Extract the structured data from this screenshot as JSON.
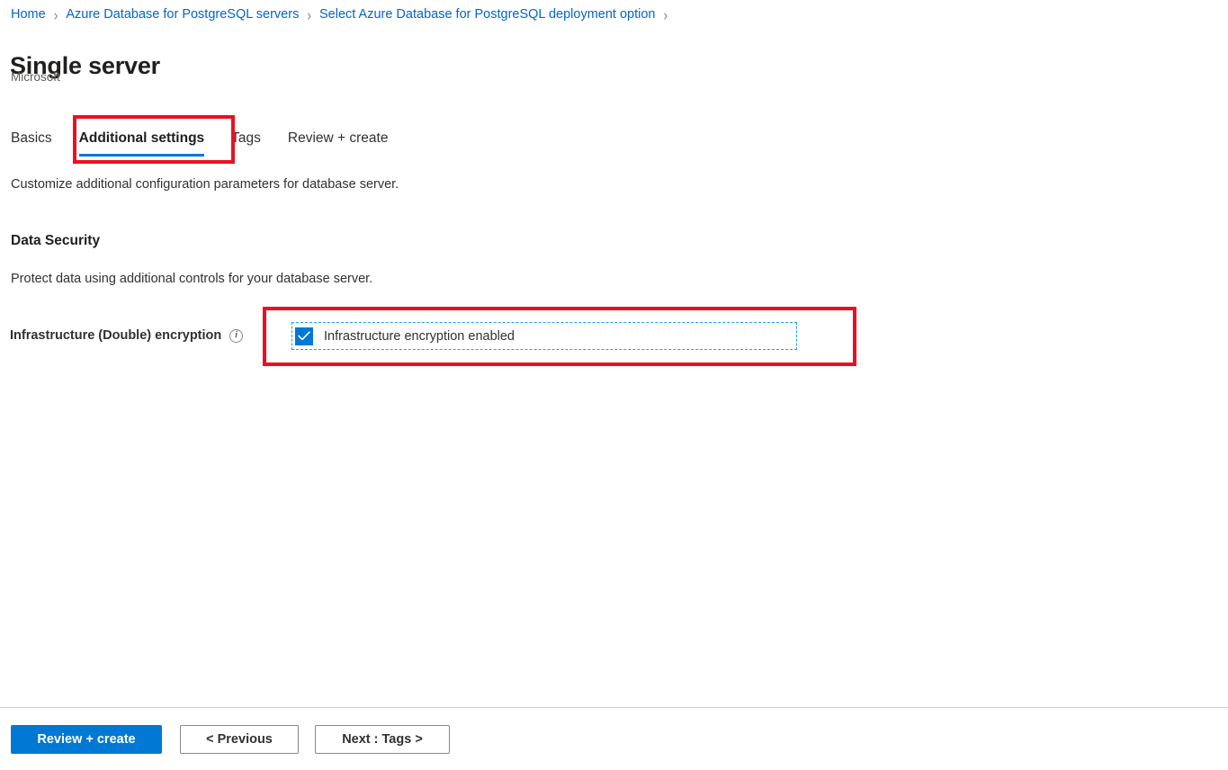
{
  "breadcrumb": {
    "separator": "›",
    "items": [
      {
        "label": "Home"
      },
      {
        "label": "Azure Database for PostgreSQL servers"
      },
      {
        "label": "Select Azure Database for PostgreSQL deployment option"
      }
    ]
  },
  "header": {
    "title": "Single server",
    "publisher": "Microsoft"
  },
  "tabs": {
    "items": [
      {
        "label": "Basics",
        "active": false
      },
      {
        "label": "Additional settings",
        "active": true
      },
      {
        "label": "Tags",
        "active": false
      },
      {
        "label": "Review + create",
        "active": false
      }
    ],
    "description": "Customize additional configuration parameters for database server."
  },
  "section": {
    "heading": "Data Security",
    "description": "Protect data using additional controls for your database server."
  },
  "field": {
    "label": "Infrastructure (Double) encryption",
    "info_icon": "info-icon",
    "checkbox_label": "Infrastructure encryption enabled",
    "checkbox_checked": true
  },
  "footer": {
    "review_create_label": "Review + create",
    "previous_label": "< Previous",
    "next_label": "Next : Tags >"
  },
  "colors": {
    "accent": "#0078d4",
    "link": "#0066cc",
    "annotation": "#e81123",
    "focus_ring": "#1aa3e8",
    "text": "#323130",
    "muted": "#605e5c"
  }
}
